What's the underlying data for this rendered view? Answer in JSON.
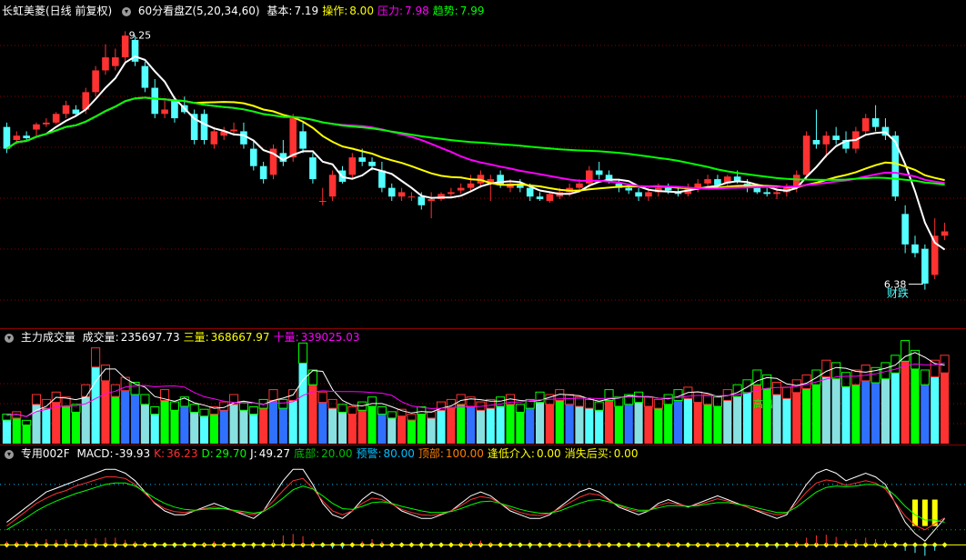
{
  "main_header": {
    "stock": "长虹美菱(日线 前复权)",
    "indicator": "60分看盘Z(5,20,34,60)",
    "fields": [
      {
        "label": "基本:",
        "value": "7.19",
        "color": "#ffffff"
      },
      {
        "label": "操作:",
        "value": "8.00",
        "color": "#ffff00"
      },
      {
        "label": "压力:",
        "value": "7.98",
        "color": "#ff00ff"
      },
      {
        "label": "趋势:",
        "value": "7.99",
        "color": "#00ff00"
      }
    ]
  },
  "volume_header": {
    "indicator": "主力成交量",
    "fields": [
      {
        "label": "成交量:",
        "value": "235697.73",
        "color": "#ffffff"
      },
      {
        "label": "三量:",
        "value": "368667.97",
        "color": "#ffff00"
      },
      {
        "label": "十量:",
        "value": "339025.03",
        "color": "#ff00ff"
      }
    ]
  },
  "macd_header": {
    "indicator": "专用002F",
    "fields": [
      {
        "label": "MACD:",
        "value": "-39.93",
        "color": "#ffffff"
      },
      {
        "label": "K:",
        "value": "36.23",
        "color": "#ff3030"
      },
      {
        "label": "D:",
        "value": "29.70",
        "color": "#00ff00"
      },
      {
        "label": "J:",
        "value": "49.27",
        "color": "#ffffff"
      },
      {
        "label": "底部:",
        "value": "20.00",
        "color": "#00c000"
      },
      {
        "label": "预警:",
        "value": "80.00",
        "color": "#00bfff"
      },
      {
        "label": "顶部:",
        "value": "100.00",
        "color": "#ff7f00"
      },
      {
        "label": "逢低介入:",
        "value": "0.00",
        "color": "#ffff00"
      },
      {
        "label": "消失后买:",
        "value": "0.00",
        "color": "#ffff00"
      }
    ]
  },
  "annotations": {
    "high_label": "9.25",
    "low_label": "6.38",
    "event_label": "财跌",
    "volume_label": "高出"
  },
  "colors": {
    "up": "#ff3232",
    "down": "#54ffff",
    "ma_white": "#ffffff",
    "ma_yellow": "#ffff00",
    "ma_magenta": "#ff00ff",
    "ma_green": "#00ff00",
    "grid": "#8b0000"
  },
  "chart_data": [
    {
      "type": "candlestick",
      "title": "60分看盘Z(5,20,34,60)",
      "ylim": [
        6.0,
        9.5
      ],
      "ohlc": [
        [
          8.25,
          8.3,
          7.95,
          8.0
        ],
        [
          8.1,
          8.2,
          8.05,
          8.15
        ],
        [
          8.15,
          8.2,
          8.1,
          8.12
        ],
        [
          8.22,
          8.3,
          8.15,
          8.28
        ],
        [
          8.28,
          8.35,
          8.25,
          8.3
        ],
        [
          8.3,
          8.42,
          8.28,
          8.4
        ],
        [
          8.4,
          8.55,
          8.35,
          8.5
        ],
        [
          8.45,
          8.5,
          8.38,
          8.4
        ],
        [
          8.45,
          8.7,
          8.4,
          8.65
        ],
        [
          8.65,
          8.95,
          8.6,
          8.9
        ],
        [
          8.9,
          9.2,
          8.85,
          9.05
        ],
        [
          8.95,
          9.15,
          8.9,
          9.05
        ],
        [
          9.05,
          9.35,
          9.0,
          9.3
        ],
        [
          9.25,
          9.3,
          8.95,
          9.0
        ],
        [
          8.95,
          9.0,
          8.65,
          8.7
        ],
        [
          8.7,
          8.8,
          8.35,
          8.4
        ],
        [
          8.4,
          8.55,
          8.35,
          8.45
        ],
        [
          8.55,
          8.6,
          8.3,
          8.35
        ],
        [
          8.5,
          8.6,
          8.4,
          8.42
        ],
        [
          8.4,
          8.45,
          8.05,
          8.1
        ],
        [
          8.4,
          8.45,
          8.05,
          8.1
        ],
        [
          8.05,
          8.25,
          8.0,
          8.2
        ],
        [
          8.15,
          8.25,
          8.1,
          8.2
        ],
        [
          8.2,
          8.3,
          8.15,
          8.22
        ],
        [
          8.2,
          8.3,
          8.0,
          8.05
        ],
        [
          8.0,
          8.1,
          7.75,
          7.8
        ],
        [
          7.8,
          7.85,
          7.6,
          7.65
        ],
        [
          7.7,
          8.05,
          7.65,
          8.0
        ],
        [
          7.95,
          8.1,
          7.8,
          7.85
        ],
        [
          7.9,
          8.4,
          7.85,
          8.35
        ],
        [
          8.2,
          8.3,
          7.95,
          8.0
        ],
        [
          7.9,
          7.95,
          7.6,
          7.65
        ],
        [
          7.4,
          7.55,
          7.35,
          7.4
        ],
        [
          7.45,
          7.75,
          7.4,
          7.7
        ],
        [
          7.75,
          7.8,
          7.6,
          7.62
        ],
        [
          7.7,
          7.95,
          7.65,
          7.9
        ],
        [
          7.9,
          8.0,
          7.8,
          7.85
        ],
        [
          7.85,
          7.9,
          7.75,
          7.8
        ],
        [
          7.75,
          7.85,
          7.5,
          7.55
        ],
        [
          7.55,
          7.6,
          7.4,
          7.45
        ],
        [
          7.45,
          7.55,
          7.4,
          7.5
        ],
        [
          7.45,
          7.5,
          7.4,
          7.45
        ],
        [
          7.45,
          7.5,
          7.3,
          7.35
        ],
        [
          7.4,
          7.5,
          7.2,
          7.42
        ],
        [
          7.42,
          7.5,
          7.4,
          7.48
        ],
        [
          7.48,
          7.55,
          7.45,
          7.5
        ],
        [
          7.52,
          7.6,
          7.48,
          7.55
        ],
        [
          7.55,
          7.7,
          7.5,
          7.6
        ],
        [
          7.6,
          7.75,
          7.55,
          7.7
        ],
        [
          7.6,
          7.7,
          7.4,
          7.65
        ],
        [
          7.7,
          7.75,
          7.55,
          7.58
        ],
        [
          7.55,
          7.65,
          7.5,
          7.6
        ],
        [
          7.6,
          7.65,
          7.5,
          7.55
        ],
        [
          7.55,
          7.6,
          7.4,
          7.45
        ],
        [
          7.45,
          7.5,
          7.4,
          7.42
        ],
        [
          7.4,
          7.5,
          7.38,
          7.48
        ],
        [
          7.45,
          7.55,
          7.42,
          7.5
        ],
        [
          7.5,
          7.6,
          7.45,
          7.55
        ],
        [
          7.55,
          7.65,
          7.5,
          7.6
        ],
        [
          7.6,
          7.8,
          7.55,
          7.75
        ],
        [
          7.75,
          7.85,
          7.65,
          7.7
        ],
        [
          7.7,
          7.75,
          7.6,
          7.62
        ],
        [
          7.6,
          7.65,
          7.5,
          7.55
        ],
        [
          7.55,
          7.6,
          7.48,
          7.52
        ],
        [
          7.5,
          7.55,
          7.4,
          7.45
        ],
        [
          7.45,
          7.55,
          7.4,
          7.5
        ],
        [
          7.5,
          7.6,
          7.45,
          7.55
        ],
        [
          7.55,
          7.6,
          7.48,
          7.52
        ],
        [
          7.5,
          7.55,
          7.45,
          7.48
        ],
        [
          7.48,
          7.6,
          7.45,
          7.55
        ],
        [
          7.55,
          7.65,
          7.5,
          7.6
        ],
        [
          7.6,
          7.7,
          7.55,
          7.65
        ],
        [
          7.65,
          7.7,
          7.55,
          7.58
        ],
        [
          7.6,
          7.7,
          7.55,
          7.68
        ],
        [
          7.68,
          7.75,
          7.6,
          7.62
        ],
        [
          7.6,
          7.65,
          7.5,
          7.55
        ],
        [
          7.55,
          7.6,
          7.48,
          7.5
        ],
        [
          7.5,
          7.55,
          7.45,
          7.48
        ],
        [
          7.48,
          7.55,
          7.42,
          7.5
        ],
        [
          7.5,
          7.6,
          7.45,
          7.55
        ],
        [
          7.55,
          7.75,
          7.5,
          7.7
        ],
        [
          7.7,
          8.2,
          7.65,
          8.15
        ],
        [
          8.1,
          8.45,
          8.0,
          8.05
        ],
        [
          8.05,
          8.2,
          7.9,
          8.15
        ],
        [
          8.15,
          8.25,
          8.05,
          8.1
        ],
        [
          8.1,
          8.2,
          7.95,
          8.0
        ],
        [
          8.0,
          8.25,
          7.95,
          8.2
        ],
        [
          8.2,
          8.4,
          8.15,
          8.35
        ],
        [
          8.35,
          8.5,
          8.2,
          8.25
        ],
        [
          8.25,
          8.35,
          8.1,
          8.15
        ],
        [
          8.15,
          8.2,
          7.4,
          7.45
        ],
        [
          7.25,
          7.35,
          6.8,
          6.9
        ],
        [
          6.9,
          7.0,
          6.75,
          6.8
        ],
        [
          6.85,
          6.9,
          6.38,
          6.45
        ],
        [
          6.55,
          7.2,
          6.5,
          7.0
        ],
        [
          7.0,
          7.15,
          6.95,
          7.05
        ]
      ]
    },
    {
      "type": "bar",
      "title": "主力成交量",
      "ylim": [
        0,
        500000
      ],
      "values": [
        120000,
        130000,
        95000,
        200000,
        180000,
        210000,
        190000,
        160000,
        240000,
        390000,
        320000,
        240000,
        270000,
        250000,
        200000,
        150000,
        220000,
        170000,
        190000,
        160000,
        140000,
        150000,
        170000,
        200000,
        170000,
        150000,
        180000,
        220000,
        180000,
        220000,
        410000,
        300000,
        210000,
        180000,
        160000,
        150000,
        170000,
        190000,
        150000,
        130000,
        140000,
        120000,
        150000,
        130000,
        170000,
        180000,
        200000,
        190000,
        170000,
        180000,
        190000,
        200000,
        160000,
        180000,
        210000,
        200000,
        220000,
        200000,
        190000,
        180000,
        170000,
        220000,
        190000,
        200000,
        210000,
        190000,
        180000,
        200000,
        220000,
        230000,
        210000,
        200000,
        190000,
        220000,
        240000,
        260000,
        300000,
        280000,
        250000,
        230000,
        260000,
        280000,
        300000,
        340000,
        330000,
        290000,
        300000,
        320000,
        310000,
        330000,
        360000,
        420000,
        380000,
        300000,
        340000,
        360000
      ]
    },
    {
      "type": "line",
      "title": "专用002F",
      "ylim": [
        -20,
        110
      ],
      "series": [
        {
          "name": "J",
          "values": [
            30,
            40,
            50,
            60,
            70,
            75,
            80,
            85,
            90,
            95,
            100,
            100,
            95,
            85,
            70,
            55,
            45,
            40,
            40,
            45,
            50,
            55,
            50,
            45,
            40,
            35,
            45,
            65,
            85,
            100,
            100,
            80,
            55,
            40,
            35,
            45,
            60,
            70,
            65,
            55,
            45,
            40,
            35,
            35,
            40,
            45,
            55,
            65,
            70,
            65,
            55,
            45,
            40,
            35,
            35,
            40,
            50,
            60,
            70,
            75,
            70,
            60,
            50,
            45,
            40,
            45,
            55,
            60,
            55,
            50,
            55,
            60,
            65,
            60,
            55,
            50,
            45,
            40,
            35,
            40,
            60,
            80,
            95,
            100,
            95,
            85,
            90,
            95,
            90,
            80,
            55,
            30,
            15,
            5,
            20,
            35
          ]
        },
        {
          "name": "K",
          "values": [
            25,
            35,
            45,
            55,
            62,
            68,
            72,
            78,
            82,
            86,
            90,
            90,
            88,
            80,
            68,
            56,
            48,
            44,
            43,
            45,
            48,
            50,
            48,
            45,
            42,
            40,
            45,
            58,
            72,
            85,
            88,
            75,
            58,
            45,
            40,
            45,
            55,
            62,
            60,
            54,
            47,
            43,
            40,
            39,
            41,
            45,
            52,
            60,
            64,
            62,
            55,
            48,
            43,
            40,
            39,
            42,
            48,
            56,
            63,
            68,
            66,
            59,
            52,
            47,
            44,
            45,
            52,
            56,
            54,
            51,
            53,
            57,
            61,
            58,
            54,
            50,
            46,
            43,
            40,
            42,
            55,
            70,
            82,
            86,
            84,
            79,
            82,
            85,
            82,
            74,
            56,
            38,
            26,
            20,
            28,
            36
          ]
        },
        {
          "name": "D",
          "values": [
            20,
            28,
            36,
            45,
            52,
            58,
            63,
            68,
            72,
            76,
            80,
            82,
            82,
            78,
            70,
            62,
            55,
            50,
            47,
            46,
            47,
            48,
            48,
            46,
            44,
            42,
            44,
            52,
            62,
            73,
            78,
            74,
            65,
            55,
            48,
            47,
            51,
            56,
            57,
            55,
            51,
            48,
            45,
            43,
            43,
            44,
            48,
            53,
            57,
            58,
            55,
            51,
            47,
            44,
            42,
            42,
            45,
            50,
            55,
            59,
            60,
            57,
            53,
            49,
            46,
            46,
            49,
            52,
            52,
            51,
            52,
            54,
            56,
            56,
            54,
            52,
            49,
            46,
            43,
            43,
            50,
            60,
            70,
            76,
            78,
            77,
            78,
            80,
            80,
            76,
            65,
            51,
            40,
            33,
            33,
            30
          ]
        }
      ]
    }
  ]
}
